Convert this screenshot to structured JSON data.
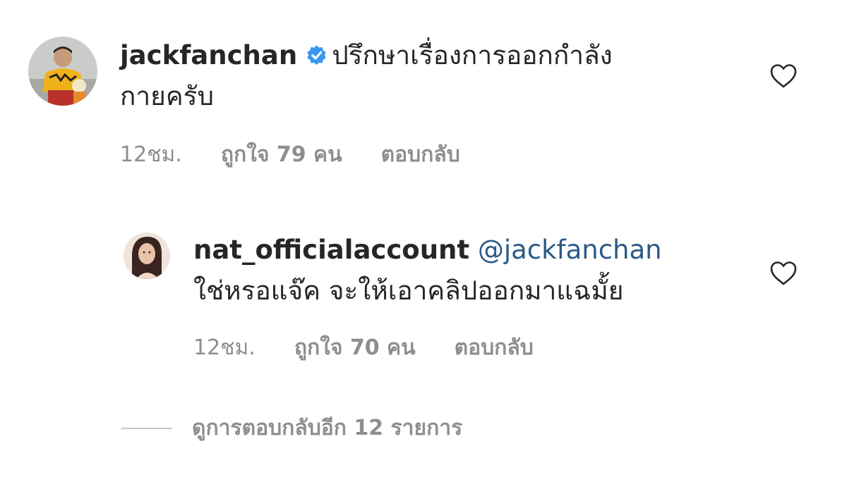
{
  "comment": {
    "username": "jackfanchan",
    "verified": true,
    "text_line1": "ปรึกษาเรื่องการออกกำลัง",
    "text_line2": "กายครับ",
    "time": "12ชม.",
    "likes": "ถูกใจ 79 คน",
    "reply_label": "ตอบกลับ",
    "avatar_icon": "avatar-photo-man-yellow-shirt",
    "like_icon": "heart-outline-icon"
  },
  "reply": {
    "username": "nat_officialaccount",
    "mention": "@jackfanchan",
    "text": "ใช่หรอแจ๊ค จะให้เอาคลิปออกมาแฉมั้ย",
    "time": "12ชม.",
    "likes": "ถูกใจ 70 คน",
    "reply_label": "ตอบกลับ",
    "avatar_icon": "avatar-photo-woman",
    "like_icon": "heart-outline-icon"
  },
  "view_replies": {
    "label": "ดูการตอบกลับอีก 12 รายการ"
  },
  "colors": {
    "text": "#262626",
    "meta": "#8e8e8e",
    "mention": "#2b5a86",
    "verified": "#3897f0"
  }
}
